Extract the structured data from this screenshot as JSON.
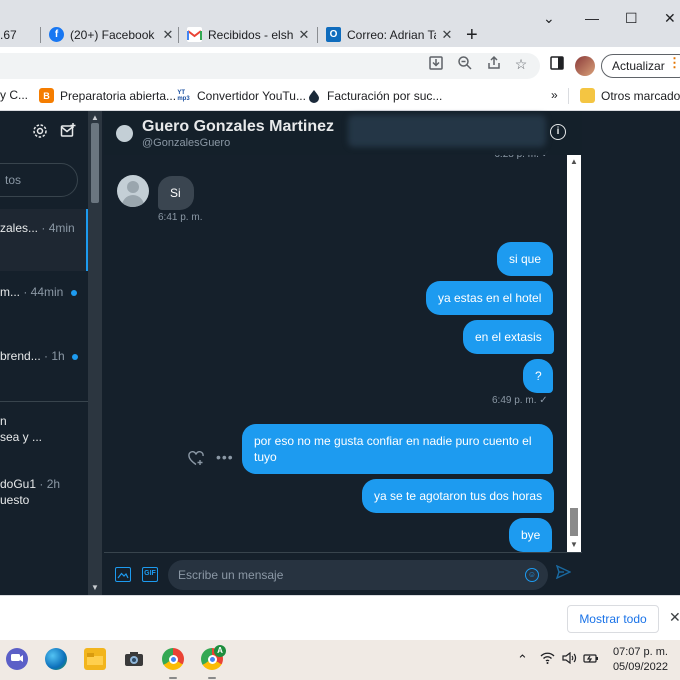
{
  "browser": {
    "tabs": [
      {
        "label": ".67",
        "icon": "partial-tab-icon"
      },
      {
        "label": "(20+) Facebook",
        "icon": "facebook-icon",
        "color": "#1877f2"
      },
      {
        "label": "Recibidos - elshal",
        "icon": "gmail-icon",
        "color": "#ea4335"
      },
      {
        "label": "Correo: Adrian Ta",
        "icon": "outlook-icon",
        "color": "#0f6cbd"
      }
    ],
    "new_tab_symbol": "+",
    "window_controls": {
      "minimize": "⌄",
      "restore": "—",
      "maximize": "☐",
      "close": "✕"
    },
    "update_button": "Actualizar",
    "bookmarks": [
      {
        "label": "y C...",
        "icon": "bookmark-fragment"
      },
      {
        "label": "Preparatoria abierta...",
        "icon": "blogger-icon",
        "color": "#f57d00"
      },
      {
        "label": "Convertidor YouTu...",
        "icon": "ytmp3-icon",
        "badge": "YT mp3"
      },
      {
        "label": "Facturación por suc...",
        "icon": "drop-icon"
      }
    ],
    "bookmarks_more": "»",
    "other_bookmarks": "Otros marcadores"
  },
  "dm_list": {
    "search_placeholder": "tos",
    "conversations": [
      {
        "name": "zales...",
        "time": "· 4min",
        "preview": "",
        "unread": false,
        "active": true
      },
      {
        "name": "m...",
        "time": "· 44min",
        "preview": "",
        "unread": true,
        "active": false
      },
      {
        "name": "brend...",
        "time": "· 1h",
        "preview": "",
        "unread": true,
        "active": false
      },
      {
        "name": "n",
        "time": "",
        "preview": "sea y ...",
        "unread": false,
        "active": false
      },
      {
        "name": "doGu1",
        "time": "· 2h",
        "preview": "uesto",
        "unread": false,
        "active": false
      }
    ]
  },
  "chat": {
    "name": "Guero Gonzales Martinez",
    "handle": "@GonzalesGuero",
    "top_timestamp": "6:28 p. m. ✓",
    "incoming": {
      "text": "Si",
      "time": "6:41 p. m."
    },
    "outgoing_group_1": [
      "si que",
      "ya estas en el hotel",
      "en el extasis",
      "?"
    ],
    "group_1_time": "6:49 p. m. ✓",
    "outgoing_group_2": [
      "por eso no me gusta confiar en nadie puro cuento el tuyo",
      "ya se te agotaron tus dos horas",
      "bye"
    ],
    "composer_placeholder": "Escribe un mensaje",
    "gif_label": "GIF"
  },
  "downloads": {
    "show_all": "Mostrar todo",
    "close": "✕"
  },
  "taskbar": {
    "apps": [
      {
        "name": "teams-chat",
        "color": "#5b5fc7"
      },
      {
        "name": "edge",
        "color": "#0c8fdc"
      },
      {
        "name": "file-explorer",
        "color": "#f2b51d"
      },
      {
        "name": "camera",
        "color": "#3a3a3a"
      },
      {
        "name": "chrome",
        "color": "#1a73e8"
      },
      {
        "name": "chrome-profile-a",
        "color": "#34a853",
        "badge": "A"
      }
    ],
    "time": "07:07 p. m.",
    "date": "05/09/2022"
  }
}
